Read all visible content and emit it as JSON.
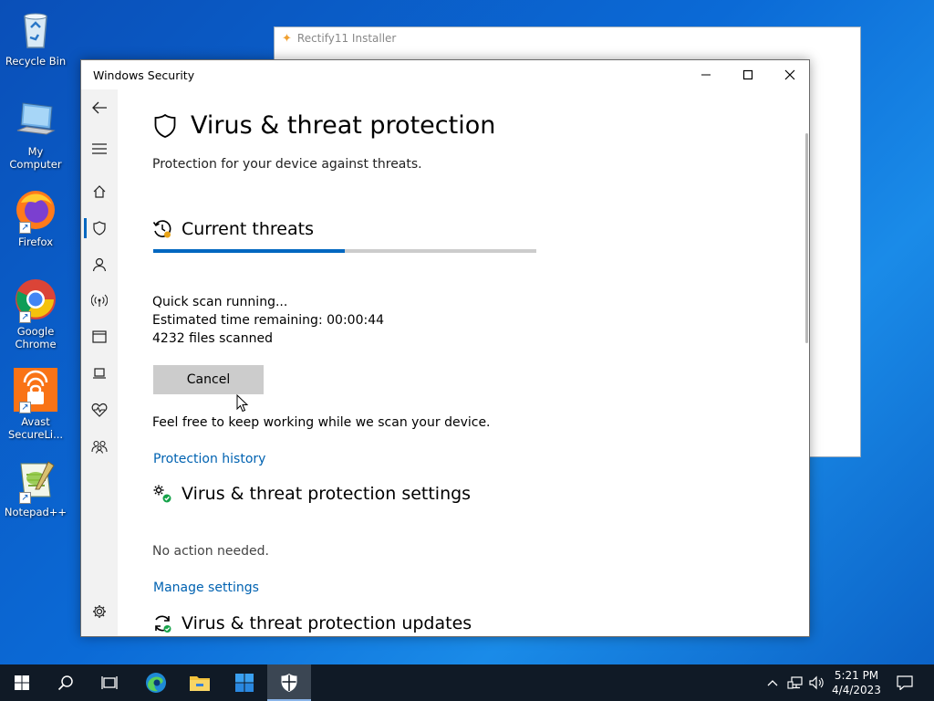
{
  "desktop": {
    "icons": [
      {
        "label": "Recycle Bin",
        "icon": "recycle-bin-icon"
      },
      {
        "label": "My Computer",
        "icon": "computer-icon"
      },
      {
        "label": "Firefox",
        "icon": "firefox-icon"
      },
      {
        "label": "Google Chrome",
        "icon": "chrome-icon"
      },
      {
        "label": "Avast SecureLi...",
        "icon": "avast-icon"
      },
      {
        "label": "Notepad++",
        "icon": "notepad-plus-plus-icon"
      }
    ]
  },
  "background_window": {
    "title": "Rectify11 Installer"
  },
  "window": {
    "title": "Windows Security",
    "page_title": "Virus & threat protection",
    "page_subtitle": "Protection for your device against threats.",
    "current_threats": {
      "heading": "Current threats",
      "progress": 0.5,
      "status": "Quick scan running...",
      "time_remaining_label": "Estimated time remaining:",
      "time_remaining_value": "00:00:44",
      "files_scanned": "4232 files scanned",
      "cancel_label": "Cancel",
      "note": "Feel free to keep working while we scan your device.",
      "history_link": "Protection history"
    },
    "settings": {
      "heading": "Virus & threat protection settings",
      "status": "No action needed.",
      "manage_link": "Manage settings"
    },
    "updates": {
      "heading": "Virus & threat protection updates"
    },
    "sidebar_items": [
      "back-icon",
      "menu-icon",
      "home-icon",
      "shield-icon",
      "person-icon",
      "wireless-icon",
      "app-browser-icon",
      "laptop-icon",
      "heart-icon",
      "family-icon",
      "settings-icon"
    ]
  },
  "taskbar": {
    "clock_time": "5:21 PM",
    "clock_date": "4/4/2023"
  },
  "colors": {
    "accent": "#0067c0",
    "link": "#0062b1",
    "taskbar": "#101a26"
  }
}
